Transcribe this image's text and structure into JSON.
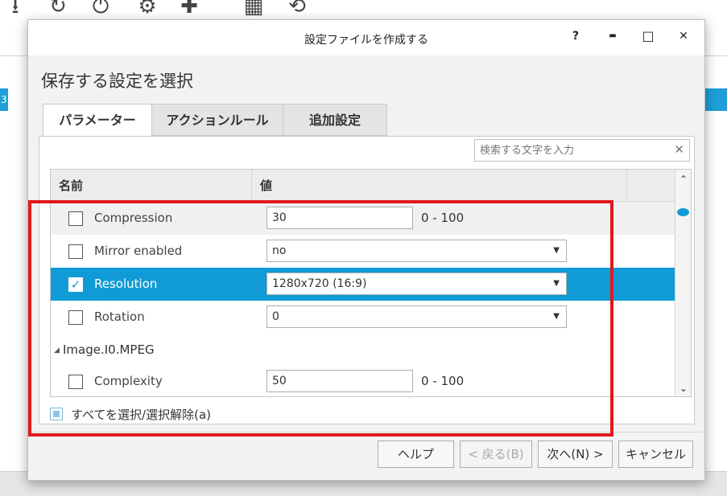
{
  "background": {
    "toolbar_icons": [
      "download-icon",
      "refresh-clock-icon",
      "power-icon",
      "adjust-icon",
      "plugin-icon",
      "film-icon",
      "sync-icon"
    ],
    "left_tag": "3"
  },
  "dialog": {
    "title": "設定ファイルを作成する",
    "controls": {
      "help": "?",
      "minimize": "▬",
      "maximize": "□",
      "close": "✕"
    },
    "heading": "保存する設定を選択",
    "tabs": [
      {
        "label": "パラメーター",
        "active": true
      },
      {
        "label": "アクションルール",
        "active": false
      },
      {
        "label": "追加設定",
        "active": false
      }
    ],
    "search": {
      "placeholder": "検索する文字を入力",
      "clear": "✕"
    },
    "grid": {
      "headers": {
        "name": "名前",
        "value": "値"
      },
      "rows": [
        {
          "name": "Compression",
          "value": "30",
          "range": "0 - 100",
          "checked": false,
          "control": "text"
        },
        {
          "name": "Mirror enabled",
          "value": "no",
          "checked": false,
          "control": "select"
        },
        {
          "name": "Resolution",
          "value": "1280x720 (16:9)",
          "checked": true,
          "control": "select",
          "selected": true
        },
        {
          "name": "Rotation",
          "value": "0",
          "checked": false,
          "control": "select"
        }
      ],
      "group": {
        "name": "Image.I0.MPEG",
        "toggle": "◢"
      },
      "group_rows": [
        {
          "name": "Complexity",
          "value": "50",
          "range": "0 - 100",
          "checked": false,
          "control": "text"
        }
      ],
      "check_mark": "✓",
      "caret": "▼",
      "scroll_up": "⌃",
      "scroll_down": "⌄"
    },
    "select_all": "すべてを選択/選択解除(a)",
    "buttons": {
      "help": "ヘルプ",
      "back": "< 戻る(B)",
      "next": "次へ(N) >",
      "cancel": "キャンセル"
    },
    "colors": {
      "accent": "#109bd6",
      "highlight": "#e0191e"
    }
  }
}
